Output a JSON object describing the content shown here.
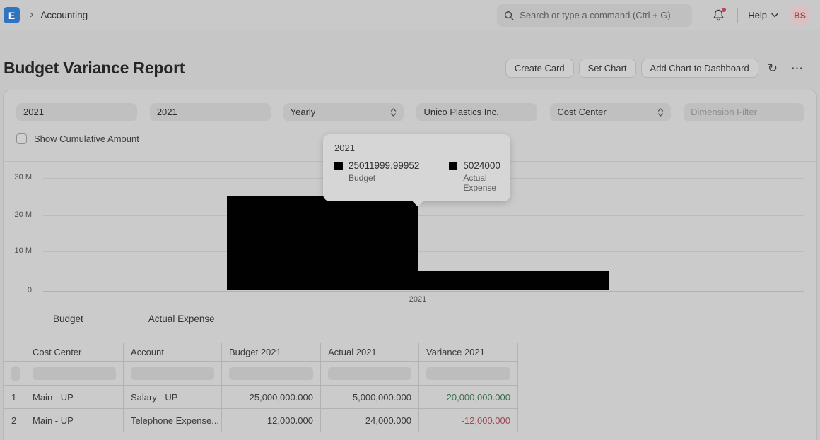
{
  "colors": {
    "page_bg": "#c6c6c6",
    "navbar_bg": "#c9c9c9",
    "card_bg": "#cbcbcb",
    "card_border": "#b7b7b7",
    "pill_bg": "#c0c0c0",
    "button_bg": "#cecece",
    "button_border": "#b3b3b3",
    "tooltip_bg": "#d6d6d6",
    "skeleton_bg": "#bdbdbd",
    "table_border": "#b2b2b2",
    "text_dark": "#2e2e2e",
    "logo_blue": "#2f74c0",
    "avatar_bg": "#dcbfc1",
    "avatar_text": "#8e4b55",
    "alert_red": "#b0485a",
    "variance_positive": "#3c6e4d",
    "variance_negative": "#9c4a52",
    "bar_color": "#010101"
  },
  "navbar": {
    "logo_letter": "E",
    "breadcrumb": "Accounting",
    "search_placeholder": "Search or type a command (Ctrl + G)",
    "help_label": "Help",
    "avatar_initials": "BS"
  },
  "page": {
    "title": "Budget Variance Report",
    "buttons": {
      "create_card": "Create Card",
      "set_chart": "Set Chart",
      "add_chart_to_dashboard": "Add Chart to Dashboard",
      "refresh_glyph": "↻",
      "menu_glyph": "⋯"
    }
  },
  "filters": {
    "from_fiscal_year": "2021",
    "to_fiscal_year": "2021",
    "period": "Yearly",
    "company": "Unico Plastics Inc.",
    "budget_against": "Cost Center",
    "dimension_filter_placeholder": "Dimension Filter",
    "show_cumulative_label": "Show Cumulative Amount"
  },
  "chart_data": {
    "type": "bar",
    "title": "",
    "categories": [
      "2021"
    ],
    "series": [
      {
        "name": "Budget",
        "values": [
          25011999.99952
        ],
        "color": "#010101"
      },
      {
        "name": "Actual Expense",
        "values": [
          5024000
        ],
        "color": "#010101"
      }
    ],
    "ylim": [
      0,
      30000000
    ],
    "yticks": [
      "30 M",
      "20 M",
      "10 M",
      "0"
    ],
    "xlabel": "",
    "ylabel": "",
    "grid": true,
    "legend_position": "bottom"
  },
  "tooltip": {
    "title": "2021",
    "entries": [
      {
        "value": "25011999.99952",
        "label": "Budget"
      },
      {
        "value": "5024000",
        "label": "Actual Expense"
      }
    ]
  },
  "table": {
    "headers": {
      "index": "",
      "cost_center": "Cost Center",
      "account": "Account",
      "budget": "Budget 2021",
      "actual": "Actual 2021",
      "variance": "Variance 2021"
    },
    "rows": [
      {
        "idx": "1",
        "cost_center": "Main - UP",
        "account": "Salary - UP",
        "budget": "25,000,000.000",
        "actual": "5,000,000.000",
        "variance": "20,000,000.000",
        "variance_positive": true
      },
      {
        "idx": "2",
        "cost_center": "Main - UP",
        "account": "Telephone Expense...",
        "budget": "12,000.000",
        "actual": "24,000.000",
        "variance": "-12,000.000",
        "variance_positive": false
      }
    ]
  }
}
